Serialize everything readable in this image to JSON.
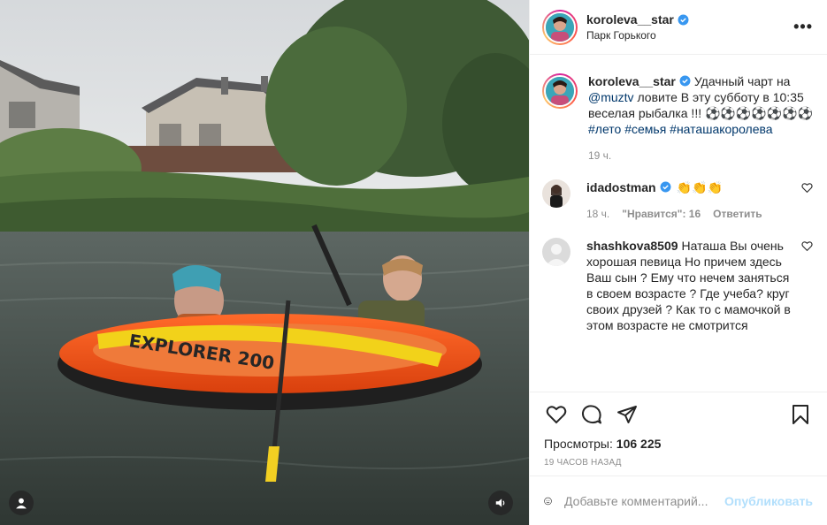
{
  "post": {
    "username": "koroleva__star",
    "location": "Парк Горького",
    "more_label": "•••"
  },
  "caption": {
    "username": "koroleva__star",
    "text_before": "Удачный чарт на ",
    "mention": "@muztv",
    "text_after": " ловите В эту субботу в 10:35 веселая рыбалка !!! ⚽⚽⚽⚽⚽⚽⚽",
    "hashtags": "#лето #семья #наташакоролева",
    "time": "19 ч."
  },
  "comments": [
    {
      "username": "idadostman",
      "text": "👏👏👏",
      "time": "18 ч.",
      "likes": "\"Нравится\": 16",
      "reply": "Ответить"
    },
    {
      "username": "shashkova8509",
      "text": "Наташа Вы очень хорошая певица Но причем здесь Ваш сын ? Ему что нечем заняться в своем возрасте ? Где учеба? круг своих друзей ? Как то с мамочкой в этом возрасте не смотрится"
    }
  ],
  "stats": {
    "views_label": "Просмотры: ",
    "views_value": "106 225",
    "time_ago": "19 часов назад"
  },
  "composer": {
    "placeholder": "Добавьте комментарий...",
    "post_label": "Опубликовать"
  },
  "colors": {
    "link": "#00376b",
    "verified": "#3897f0",
    "post_disabled": "#b2dffc"
  }
}
